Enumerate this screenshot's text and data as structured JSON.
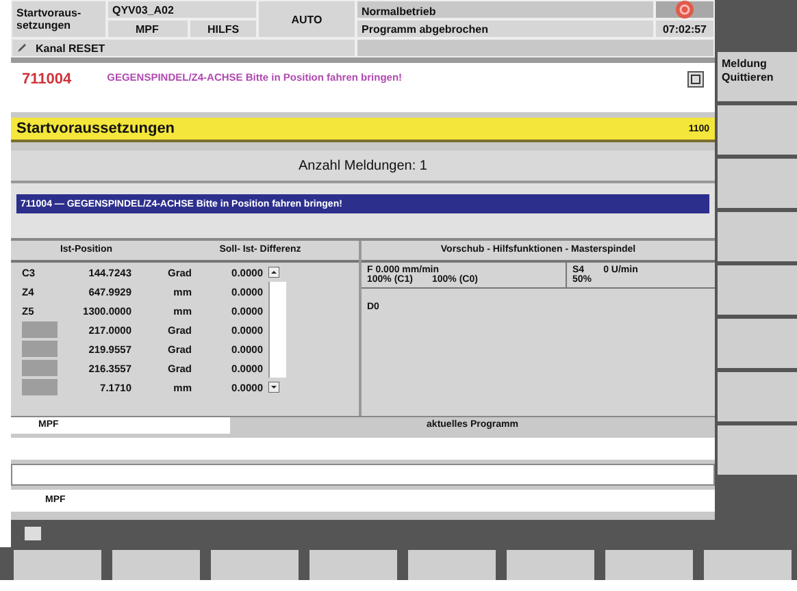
{
  "header": {
    "area": [
      "Startvoraus-",
      "setzungen"
    ],
    "program_path": "QYV03_A02",
    "program_type": "MPF",
    "mode_sub": "HILFS",
    "mode": "AUTO",
    "channel_status": "Kanal RESET",
    "operation": "Normalbetrieb",
    "program_status": "Programm abgebrochen",
    "time": "07:02:57"
  },
  "alarm": {
    "number": "711004",
    "text": "GEGENSPINDEL/Z4-ACHSE Bitte in Position fahren bringen!"
  },
  "title": {
    "text": "Startvoraussetzungen",
    "number": "1100"
  },
  "count": "Anzahl Meldungen: 1",
  "messages": [
    {
      "text": "711004 — GEGENSPINDEL/Z4-ACHSE Bitte in Position fahren bringen!",
      "selected": true
    }
  ],
  "axes": {
    "headers": [
      "Ist-Position",
      "Soll- Ist- Differenz"
    ],
    "rows": [
      {
        "axis": "C3",
        "value": "144.7243",
        "unit": "Grad",
        "diff": "0.0000",
        "kind": "named"
      },
      {
        "axis": "Z4",
        "value": "647.9929",
        "unit": "mm",
        "diff": "0.0000",
        "kind": "named"
      },
      {
        "axis": "Z5",
        "value": "1300.0000",
        "unit": "mm",
        "diff": "0.0000",
        "kind": "named"
      },
      {
        "value": "217.0000",
        "unit": "Grad",
        "diff": "0.0000",
        "kind": "masked"
      },
      {
        "value": "219.9557",
        "unit": "Grad",
        "diff": "0.0000",
        "kind": "masked"
      },
      {
        "value": "216.3557",
        "unit": "Grad",
        "diff": "0.0000",
        "kind": "masked"
      },
      {
        "value": "7.1710",
        "unit": "mm",
        "diff": "0.0000",
        "kind": "masked"
      }
    ]
  },
  "feed": {
    "header": "Vorschub - Hilfsfunktionen - Masterspindel",
    "feed": "F 0.000 mm/min",
    "override1": "100% (C1)",
    "override2": "100% (C0)",
    "spindle": "S4",
    "speed": "0 U/min",
    "spindle_override": "50%",
    "tool": "D0"
  },
  "program": {
    "name": "MPF",
    "label": "aktuelles Programm",
    "last_line": "MPF"
  },
  "softkeys_right": [
    "Meldung Quittieren"
  ]
}
